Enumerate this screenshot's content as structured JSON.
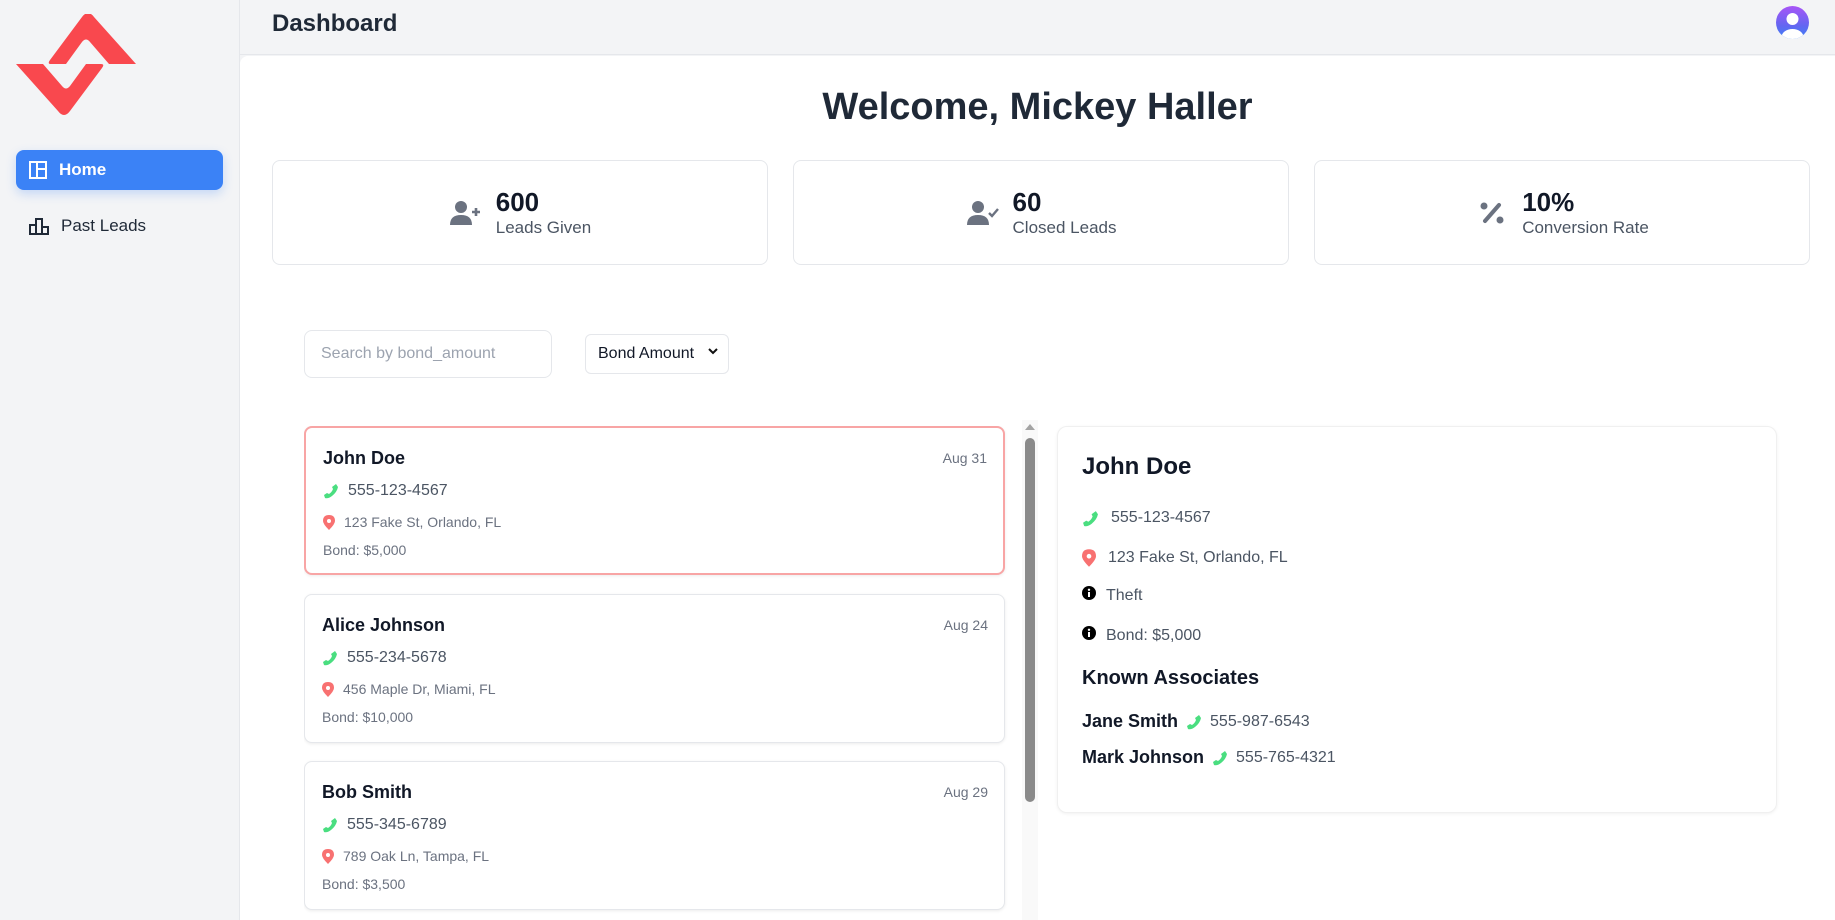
{
  "sidebar": {
    "logo_color": "#f9484e",
    "items": [
      {
        "label": "Home",
        "icon": "layout-icon",
        "active": true
      },
      {
        "label": "Past Leads",
        "icon": "bar-chart-icon",
        "active": false
      }
    ]
  },
  "header": {
    "title": "Dashboard",
    "avatar": "user-avatar-icon"
  },
  "main": {
    "welcome": "Welcome, Mickey Haller",
    "stats": [
      {
        "value": "600",
        "label": "Leads Given",
        "icon": "user-plus-icon"
      },
      {
        "value": "60",
        "label": "Closed Leads",
        "icon": "user-check-icon"
      },
      {
        "value": "10%",
        "label": "Conversion Rate",
        "icon": "percent-icon"
      }
    ],
    "search": {
      "placeholder": "Search by bond_amount",
      "value": ""
    },
    "sort_select": {
      "selected": "Bond Amount"
    },
    "leads": [
      {
        "name": "John Doe",
        "date": "Aug 31",
        "phone": "555-123-4567",
        "address": "123 Fake St, Orlando, FL",
        "bond": "Bond: $5,000",
        "selected": true
      },
      {
        "name": "Alice Johnson",
        "date": "Aug 24",
        "phone": "555-234-5678",
        "address": "456 Maple Dr, Miami, FL",
        "bond": "Bond: $10,000",
        "selected": false
      },
      {
        "name": "Bob Smith",
        "date": "Aug 29",
        "phone": "555-345-6789",
        "address": "789 Oak Ln, Tampa, FL",
        "bond": "Bond: $3,500",
        "selected": false
      }
    ],
    "detail": {
      "name": "John Doe",
      "phone": "555-123-4567",
      "address": "123 Fake St, Orlando, FL",
      "charge": "Theft",
      "bond": "Bond: $5,000",
      "associates_title": "Known Associates",
      "associates": [
        {
          "name": "Jane Smith",
          "phone": "555-987-6543"
        },
        {
          "name": "Mark Johnson",
          "phone": "555-765-4321"
        }
      ]
    }
  },
  "colors": {
    "accent": "#3b82f6",
    "phone_icon": "#4ade80",
    "location_icon": "#f87171",
    "selected_border": "#f8a5a5"
  }
}
